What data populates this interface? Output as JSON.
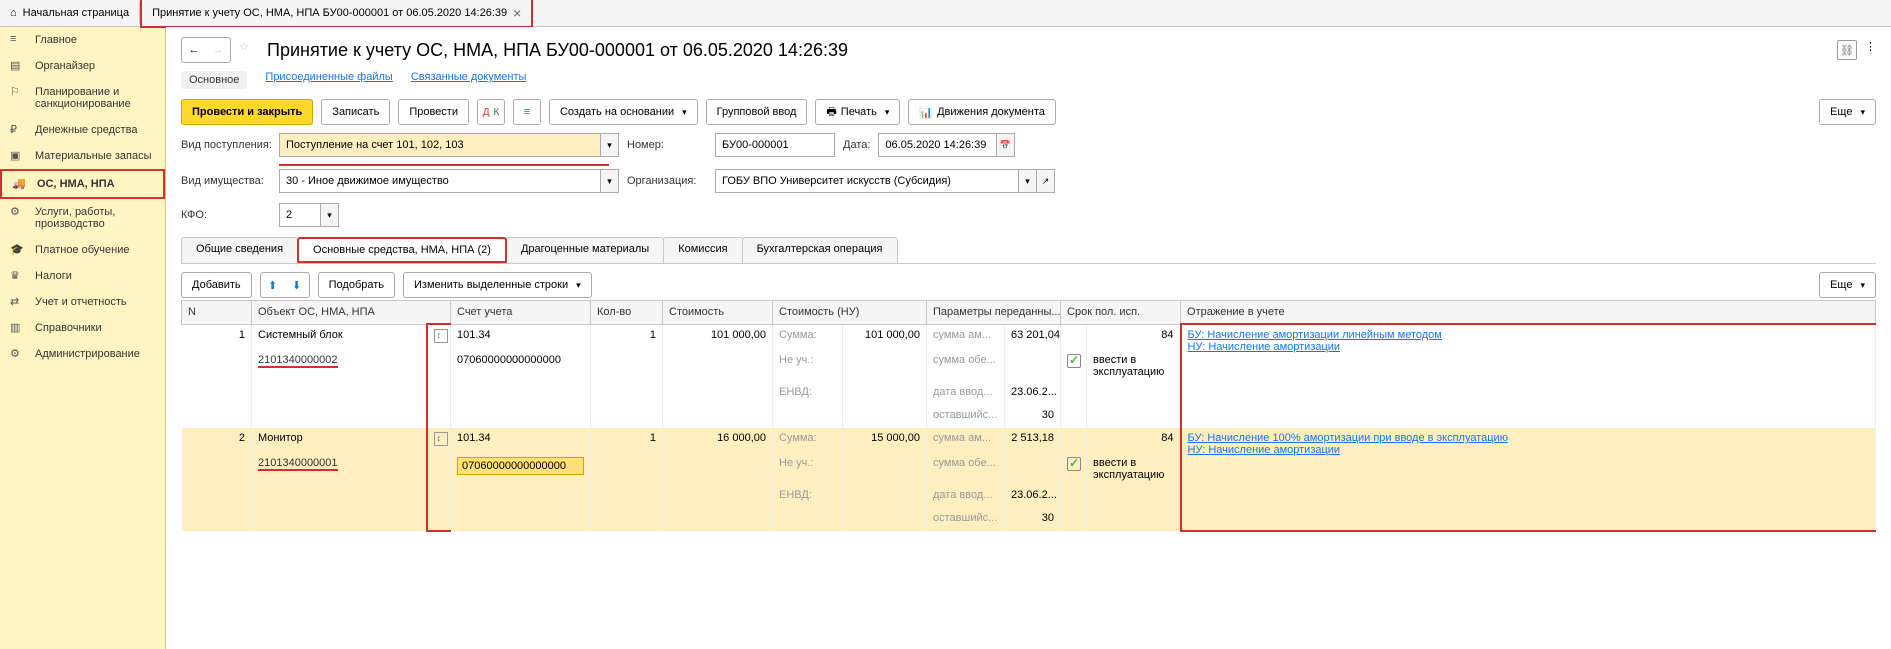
{
  "tabs": {
    "home": "Начальная страница",
    "doc": "Принятие к учету ОС, НМА, НПА БУ00-000001 от 06.05.2020 14:26:39"
  },
  "nav": {
    "main": "Главное",
    "organizer": "Органайзер",
    "planning": "Планирование и санкционирование",
    "cash": "Денежные средства",
    "materials": "Материальные запасы",
    "os": "ОС, НМА, НПА",
    "services": "Услуги, работы, производство",
    "education": "Платное обучение",
    "taxes": "Налоги",
    "reporting": "Учет и отчетность",
    "reference": "Справочники",
    "admin": "Администрирование"
  },
  "header": {
    "title": "Принятие к учету ОС, НМА, НПА БУ00-000001 от 06.05.2020 14:26:39"
  },
  "subnav": {
    "main": "Основное",
    "files": "Присоединенные файлы",
    "related": "Связанные документы"
  },
  "cmdbar": {
    "post_close": "Провести и закрыть",
    "save": "Записать",
    "post": "Провести",
    "create_based": "Создать на основании",
    "group_input": "Групповой ввод",
    "print": "Печать",
    "movements": "Движения документа",
    "more": "Еще"
  },
  "form": {
    "receipt_type_label": "Вид поступления:",
    "receipt_type": "Поступление на счет 101, 102, 103",
    "number_label": "Номер:",
    "number": "БУ00-000001",
    "date_label": "Дата:",
    "date": "06.05.2020 14:26:39",
    "property_type_label": "Вид имущества:",
    "property_type": "30 - Иное движимое имущество",
    "org_label": "Организация:",
    "org": "ГОБУ ВПО Университет искусств (Субсидия)",
    "kfo_label": "КФО:",
    "kfo": "2"
  },
  "inner_tabs": {
    "general": "Общие сведения",
    "os": "Основные средства, НМА, НПА (2)",
    "precious": "Драгоценные материалы",
    "commission": "Комиссия",
    "accounting": "Бухгалтерская операция"
  },
  "tbl_cmd": {
    "add": "Добавить",
    "pick": "Подобрать",
    "edit_selected": "Изменить выделенные строки",
    "more": "Еще"
  },
  "tbl_head": {
    "n": "N",
    "obj": "Объект ОС, НМА, НПА",
    "acct": "Счет учета",
    "qty": "Кол-во",
    "cost": "Стоимость",
    "cost_nu": "Стоимость (НУ)",
    "params": "Параметры переданны...",
    "srok": "Срок пол. исп.",
    "refl": "Отражение в учете"
  },
  "rows": [
    {
      "n": "1",
      "name": "Системный блок",
      "code": "2101340000002",
      "acct": "101.34",
      "acct2": "07060000000000000",
      "qty": "1",
      "cost": "101 000,00",
      "nu_label1": "Сумма:",
      "nu_val1": "101 000,00",
      "nu_label2": "Не уч.:",
      "nu_label3": "ЕНВД:",
      "p1_label": "сумма ам...",
      "p1_val": "63 201,04",
      "p2_label": "сумма обе...",
      "p3_label": "дата ввод...",
      "p3_val": "23.06.2...",
      "p4_label": "оставшийс...",
      "p4_val": "30",
      "srok": "84",
      "chk_label": "ввести в эксплуатацию",
      "refl1": "БУ: Начисление амортизации линейным методом",
      "refl2": "НУ: Начисление амортизации"
    },
    {
      "n": "2",
      "name": "Монитор",
      "code": "2101340000001",
      "acct": "101.34",
      "acct2": "07060000000000000",
      "qty": "1",
      "cost": "16 000,00",
      "nu_label1": "Сумма:",
      "nu_val1": "15 000,00",
      "nu_label2": "Не уч.:",
      "nu_label3": "ЕНВД:",
      "p1_label": "сумма ам...",
      "p1_val": "2 513,18",
      "p2_label": "сумма обе...",
      "p3_label": "дата ввод...",
      "p3_val": "23.06.2...",
      "p4_label": "оставшийс...",
      "p4_val": "30",
      "srok": "84",
      "chk_label": "ввести в эксплуатацию",
      "refl1": "БУ: Начисление 100% амортизации при вводе в эксплуатацию",
      "refl2": "НУ: Начисление амортизации"
    }
  ]
}
